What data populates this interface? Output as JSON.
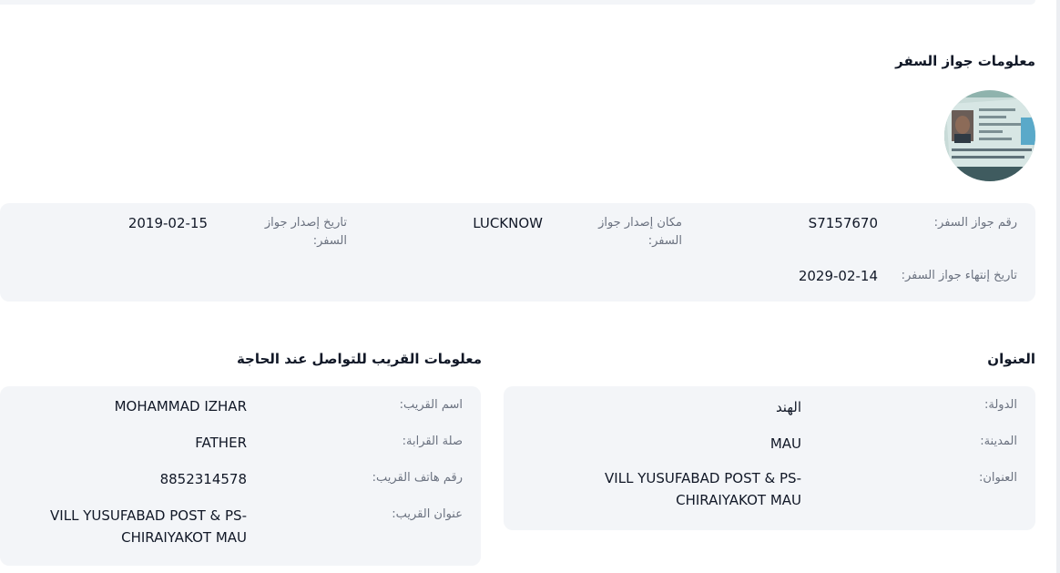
{
  "passport": {
    "title": "معلومات جواز السفر",
    "photo_icon": "passport-photo",
    "number_label": "رقم جواز السفر:",
    "number_value": "S7157670",
    "place_label": "مكان إصدار جواز السفر:",
    "place_value": "LUCKNOW",
    "issue_label": "تاريخ إصدار جواز السفر:",
    "issue_value": "2019-02-15",
    "expiry_label": "تاريخ إنتهاء جواز السفر:",
    "expiry_value": "2029-02-14"
  },
  "address": {
    "title": "العنوان",
    "country_label": "الدولة:",
    "country_value": "الهند",
    "city_label": "المدينة:",
    "city_value": "MAU",
    "address_label": "العنوان:",
    "address_value": "VILL YUSUFABAD POST & PS-CHIRAIYAKOT MAU"
  },
  "relative": {
    "title": "معلومات القريب للتواصل عند الحاجة",
    "name_label": "اسم القريب:",
    "name_value": "MOHAMMAD IZHAR",
    "relation_label": "صلة القرابة:",
    "relation_value": "FATHER",
    "phone_label": "رقم هاتف القريب:",
    "phone_value": "8852314578",
    "address_label": "عنوان القريب:",
    "address_value": "VILL YUSUFABAD POST & PS-CHIRAIYAKOT MAU"
  }
}
